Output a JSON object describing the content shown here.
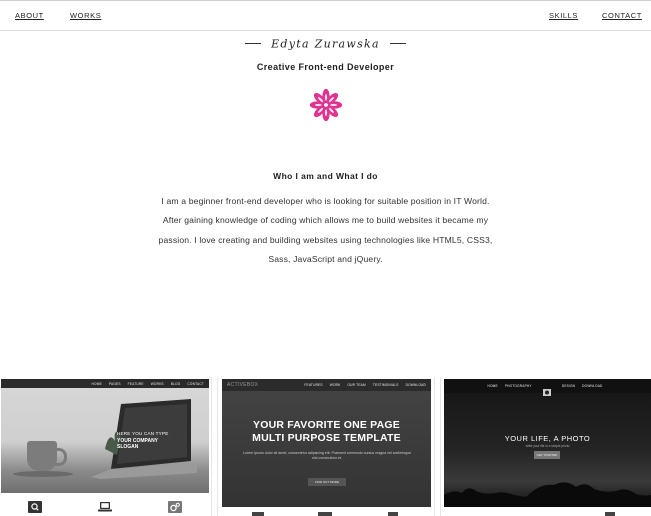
{
  "nav": {
    "left": [
      "ABOUT",
      "WORKS"
    ],
    "right": [
      "SKILLS",
      "CONTACT"
    ]
  },
  "header": {
    "name": "Edyta Zurawska",
    "role": "Creative Front-end Developer",
    "logo_icon": "flower-icon",
    "logo_color": "#e0338f"
  },
  "about": {
    "title": "Who I am and What I do",
    "text": "I am a beginner front-end developer who is looking for suitable position in IT World. After gaining knowledge of coding which allows me to build websites it became my passion. I love creating and building websites using technologies like HTML5, CSS3, Sass, JavaScript and jQuery."
  },
  "projects": [
    {
      "nav": [
        "HOME",
        "PAGES",
        "FEATURE",
        "WORKS",
        "BLOG",
        "CONTACT"
      ],
      "hero_line1": "HERE YOU CAN TYPE",
      "hero_line2": "YOUR COMPANY",
      "hero_line3": "SLOGAN",
      "icons": [
        "search-icon",
        "laptop-icon",
        "gears-icon"
      ]
    },
    {
      "brand": "ACTIVEBOX",
      "nav": [
        "FEATURES",
        "WORK",
        "OUR TEAM",
        "TESTIMONIALS",
        "DOWNLOAD"
      ],
      "title_line1": "YOUR FAVORITE ONE PAGE",
      "title_line2": "MULTI PURPOSE TEMPLATE",
      "subtitle": "Lorem ipsum dolor sit amet, consectetur adipiscing elit. Praesent commodo cursus magna vel scelerisque nisl consectetur et.",
      "button": "FIND OUT MORE"
    },
    {
      "nav": [
        "HOME",
        "PHOTOGRAPHY",
        "DESIGN",
        "DOWNLOAD"
      ],
      "title": "YOUR LIFE, A PHOTO",
      "subtitle": "write your life in a simple photo",
      "button": "GET STARTED"
    }
  ]
}
